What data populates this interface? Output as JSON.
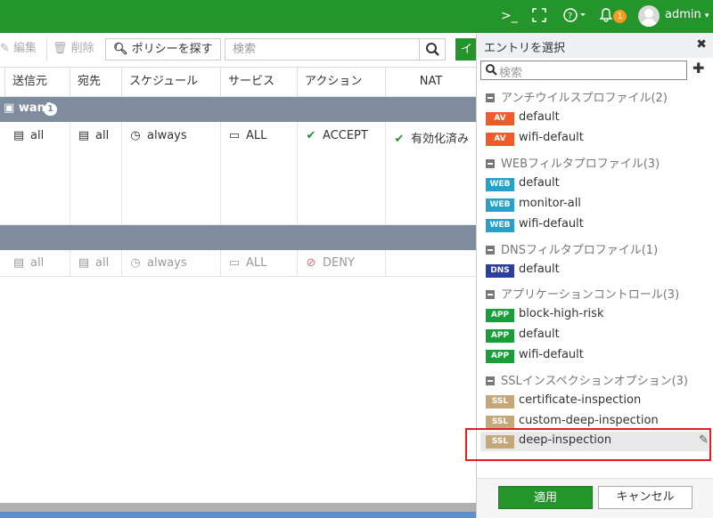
{
  "topbar": {
    "cli_icon": ">_",
    "fullscreen_icon": "fullscreen-icon",
    "help_icon": "?",
    "notification_count": "1",
    "username": "admin"
  },
  "toolbar": {
    "edit_label": "編集",
    "delete_label": "削除",
    "find_policy_label": "ポリシーを探す",
    "search_placeholder": "検索",
    "green_button_label": "イ"
  },
  "table": {
    "headers": [
      "送信元",
      "宛先",
      "スケジュール",
      "サービス",
      "アクション",
      "NAT"
    ],
    "group1": {
      "name": "wan1",
      "count": "1"
    },
    "row1": {
      "src": "all",
      "dst": "all",
      "schedule": "always",
      "service": "ALL",
      "action": "ACCEPT",
      "nat": "有効化済み"
    },
    "row2": {
      "src": "all",
      "dst": "all",
      "schedule": "always",
      "service": "ALL",
      "action": "DENY"
    }
  },
  "panel": {
    "title": "エントリを選択",
    "search_placeholder": "検索",
    "categories": [
      {
        "label": "アンチウイルスプロファイル(2)",
        "items": [
          {
            "tag": "AV",
            "label": "default"
          },
          {
            "tag": "AV",
            "label": "wifi-default"
          }
        ]
      },
      {
        "label": "WEBフィルタプロファイル(3)",
        "items": [
          {
            "tag": "WEB",
            "label": "default"
          },
          {
            "tag": "WEB",
            "label": "monitor-all"
          },
          {
            "tag": "WEB",
            "label": "wifi-default"
          }
        ]
      },
      {
        "label": "DNSフィルタプロファイル(1)",
        "items": [
          {
            "tag": "DNS",
            "label": "default"
          }
        ]
      },
      {
        "label": "アプリケーションコントロール(3)",
        "items": [
          {
            "tag": "APP",
            "label": "block-high-risk"
          },
          {
            "tag": "APP",
            "label": "default"
          },
          {
            "tag": "APP",
            "label": "wifi-default"
          }
        ]
      },
      {
        "label": "SSLインスペクションオプション(3)",
        "items": [
          {
            "tag": "SSL",
            "label": "certificate-inspection"
          },
          {
            "tag": "SSL",
            "label": "custom-deep-inspection"
          },
          {
            "tag": "SSL",
            "label": "deep-inspection"
          }
        ]
      }
    ],
    "apply_label": "適用",
    "cancel_label": "キャンセル"
  },
  "colors": {
    "brand_green": "#23952b",
    "av": "#f05a28",
    "web": "#2aa0c8",
    "dns": "#2a3f9e",
    "app": "#1a9e3a",
    "ssl": "#c5a77c"
  }
}
